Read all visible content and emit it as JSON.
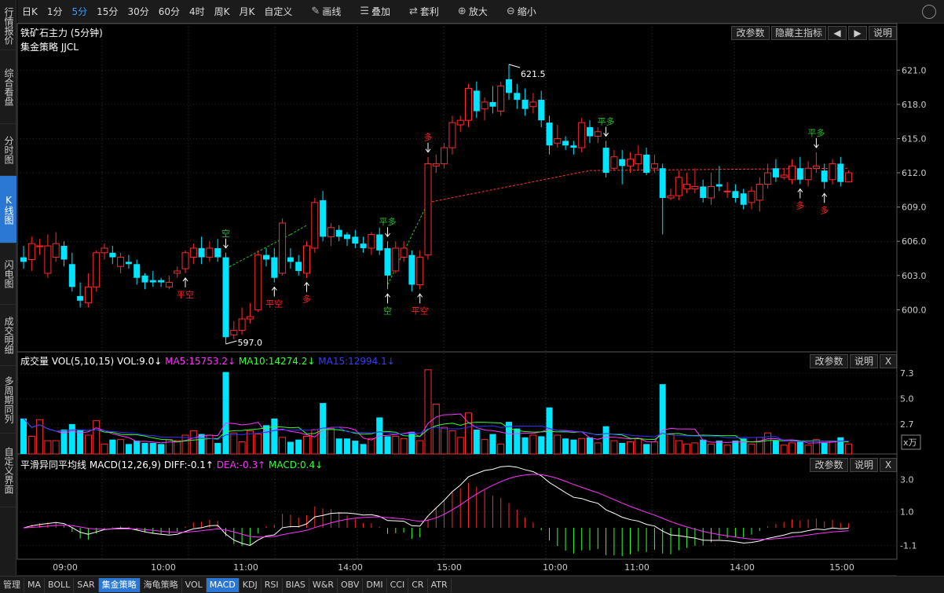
{
  "toolbar": {
    "periods": [
      "日K",
      "1分",
      "5分",
      "15分",
      "30分",
      "60分",
      "4时",
      "周K",
      "月K",
      "自定义"
    ],
    "active_period": "5分",
    "tools": [
      {
        "label": "画线",
        "icon": "pencil-icon"
      },
      {
        "label": "叠加",
        "icon": "stack-icon"
      },
      {
        "label": "套利",
        "icon": "swap-icon"
      },
      {
        "label": "放大",
        "icon": "zoom-in-icon"
      },
      {
        "label": "缩小",
        "icon": "zoom-out-icon"
      }
    ]
  },
  "sidebar": {
    "tabs": [
      "行情报价",
      "综合看盘",
      "分时图",
      "K线图",
      "闪电图",
      "成交明细",
      "多周期同列",
      "自定义界面"
    ],
    "active": "K线图"
  },
  "main_chart": {
    "title": "铁矿石主力 (5分钟)",
    "strategy": "集金策略 JJCL",
    "buttons": [
      "改参数",
      "隐藏主指标",
      "◀",
      "▶",
      "说明"
    ],
    "price_ticks": [
      "621.0",
      "618.0",
      "615.0",
      "612.0",
      "609.0",
      "606.0",
      "603.0",
      "600.0"
    ],
    "high_label": "621.5",
    "low_label": "597.0",
    "colors": {
      "up": "#ff2a2a",
      "down": "#00e5ff",
      "signal_green": "#22c522",
      "signal_red": "#ff2020",
      "line_red": "#ff3333"
    }
  },
  "volume_panel": {
    "title": "成交量",
    "params": "VOL(5,10,15)",
    "vol": "VOL:9.0↓",
    "ma5": "MA5:15753.2↓",
    "ma10": "MA10:14274.2↓",
    "ma15": "MA15:12994.1↓",
    "buttons": [
      "改参数",
      "说明",
      "X"
    ],
    "ticks": [
      "7.3",
      "5.0",
      "2.7"
    ],
    "unit": "x万",
    "colors": {
      "ma5": "#ff33ff",
      "ma10": "#33ff33",
      "ma15": "#3333ff"
    }
  },
  "macd_panel": {
    "title": "平滑异同平均线",
    "params": "MACD(12,26,9)",
    "diff": "DIFF:-0.1↑",
    "dea": "DEA:-0.3↑",
    "macd": "MACD:0.4↓",
    "buttons": [
      "改参数",
      "说明",
      "X"
    ],
    "ticks": [
      "3.0",
      "1.0",
      "-1.1"
    ]
  },
  "time_axis": [
    "09:00",
    "10:00",
    "11:00",
    "14:00",
    "15:00",
    "10:00",
    "11:00",
    "14:00",
    "15:00"
  ],
  "bottom_tabs": [
    "管理",
    "MA",
    "BOLL",
    "SAR",
    "集金策略",
    "海龟策略",
    "VOL",
    "MACD",
    "KDJ",
    "RSI",
    "BIAS",
    "W&R",
    "OBV",
    "DMI",
    "CCI",
    "CR",
    "ATR"
  ],
  "bottom_active": [
    "集金策略",
    "MACD"
  ],
  "chart_data": {
    "type": "candlestick",
    "instrument": "铁矿石主力",
    "period": "5分钟",
    "candles": [
      [
        604.6,
        604.2,
        605.6,
        603.6
      ],
      [
        604.4,
        605.8,
        606.4,
        603.4
      ],
      [
        605.6,
        605.6,
        606.2,
        604.8
      ],
      [
        603.2,
        605.6,
        606.6,
        602.8
      ],
      [
        604.6,
        605.8,
        606.8,
        604.2
      ],
      [
        605.6,
        604.4,
        606.0,
        603.8
      ],
      [
        604.0,
        602.0,
        605.0,
        601.6
      ],
      [
        601.2,
        600.8,
        602.4,
        600.2
      ],
      [
        600.6,
        602.0,
        603.2,
        600.2
      ],
      [
        602.0,
        605.0,
        605.2,
        601.6
      ],
      [
        605.0,
        605.4,
        605.8,
        604.4
      ],
      [
        605.0,
        604.6,
        605.6,
        604.0
      ],
      [
        603.8,
        604.6,
        605.0,
        603.2
      ],
      [
        604.2,
        604.0,
        604.8,
        603.6
      ],
      [
        604.0,
        602.8,
        604.4,
        602.2
      ],
      [
        603.0,
        602.4,
        603.2,
        601.8
      ],
      [
        602.6,
        602.4,
        603.4,
        602.0
      ],
      [
        602.6,
        602.4,
        602.8,
        602.0
      ],
      [
        602.0,
        602.4,
        603.0,
        601.8
      ],
      [
        603.2,
        603.4,
        603.8,
        602.8
      ],
      [
        603.6,
        605.0,
        605.2,
        603.2
      ],
      [
        604.6,
        605.4,
        605.8,
        604.0
      ],
      [
        605.4,
        604.6,
        606.4,
        604.0
      ],
      [
        604.6,
        605.4,
        606.0,
        604.2
      ],
      [
        605.4,
        604.6,
        606.2,
        604.2
      ],
      [
        604.6,
        597.6,
        605.0,
        597.0
      ],
      [
        597.8,
        598.2,
        599.0,
        597.4
      ],
      [
        598.2,
        599.2,
        600.2,
        597.8
      ],
      [
        599.2,
        599.4,
        600.6,
        598.8
      ],
      [
        600.0,
        604.8,
        605.2,
        599.8
      ],
      [
        604.8,
        604.4,
        605.4,
        603.8
      ],
      [
        604.6,
        602.8,
        605.4,
        602.4
      ],
      [
        603.2,
        607.6,
        608.0,
        603.0
      ],
      [
        604.6,
        604.2,
        605.4,
        603.6
      ],
      [
        604.2,
        603.4,
        604.8,
        603.0
      ],
      [
        603.2,
        605.6,
        606.0,
        602.8
      ],
      [
        605.4,
        609.4,
        609.8,
        605.0
      ],
      [
        609.6,
        606.4,
        610.4,
        606.0
      ],
      [
        606.4,
        607.2,
        607.6,
        605.6
      ],
      [
        607.0,
        606.4,
        607.4,
        606.0
      ],
      [
        606.6,
        606.2,
        606.8,
        605.6
      ],
      [
        606.4,
        605.8,
        607.0,
        605.4
      ],
      [
        605.8,
        605.4,
        606.4,
        605.0
      ],
      [
        605.4,
        606.6,
        606.8,
        604.8
      ],
      [
        606.6,
        605.2,
        607.2,
        604.8
      ],
      [
        605.4,
        603.0,
        606.0,
        601.8
      ],
      [
        603.4,
        605.4,
        606.0,
        603.2
      ],
      [
        604.6,
        605.4,
        606.0,
        604.2
      ],
      [
        604.8,
        602.2,
        605.2,
        601.6
      ],
      [
        602.2,
        604.6,
        605.2,
        601.8
      ],
      [
        604.8,
        612.8,
        613.4,
        604.4
      ],
      [
        612.6,
        612.8,
        613.6,
        612.0
      ],
      [
        612.8,
        614.2,
        614.6,
        612.4
      ],
      [
        614.2,
        616.4,
        617.0,
        613.6
      ],
      [
        616.2,
        616.6,
        617.0,
        615.6
      ],
      [
        616.6,
        619.4,
        619.8,
        616.0
      ],
      [
        619.2,
        617.4,
        620.0,
        616.8
      ],
      [
        617.6,
        618.2,
        618.6,
        616.6
      ],
      [
        618.2,
        617.8,
        619.6,
        617.2
      ],
      [
        617.4,
        619.6,
        620.0,
        617.0
      ],
      [
        620.2,
        619.0,
        621.5,
        618.4
      ],
      [
        619.0,
        618.4,
        619.8,
        617.6
      ],
      [
        618.4,
        617.6,
        619.4,
        617.0
      ],
      [
        617.8,
        618.2,
        619.0,
        617.2
      ],
      [
        618.4,
        616.6,
        619.2,
        616.0
      ],
      [
        616.4,
        614.4,
        617.0,
        613.6
      ],
      [
        614.6,
        615.0,
        616.2,
        614.2
      ],
      [
        614.8,
        614.4,
        615.2,
        614.0
      ],
      [
        614.4,
        614.2,
        614.8,
        613.6
      ],
      [
        614.2,
        616.4,
        616.8,
        613.8
      ],
      [
        616.0,
        615.2,
        616.6,
        614.6
      ],
      [
        615.2,
        615.6,
        616.0,
        614.6
      ],
      [
        614.2,
        612.0,
        614.8,
        611.6
      ],
      [
        612.4,
        613.4,
        614.0,
        612.2
      ],
      [
        613.2,
        612.6,
        614.0,
        611.0
      ],
      [
        612.6,
        613.2,
        613.8,
        612.0
      ],
      [
        612.8,
        613.6,
        614.4,
        612.2
      ],
      [
        613.6,
        612.0,
        614.2,
        611.8
      ],
      [
        612.4,
        612.8,
        613.6,
        612.0
      ],
      [
        612.4,
        609.8,
        612.8,
        606.6
      ],
      [
        609.8,
        610.0,
        610.6,
        609.6
      ],
      [
        610.0,
        611.6,
        612.2,
        609.6
      ],
      [
        610.6,
        611.0,
        612.0,
        610.2
      ],
      [
        610.6,
        610.8,
        612.4,
        610.2
      ],
      [
        610.8,
        609.8,
        611.4,
        609.4
      ],
      [
        609.8,
        610.8,
        612.0,
        609.2
      ],
      [
        611.0,
        610.8,
        612.6,
        610.4
      ],
      [
        610.4,
        610.4,
        611.2,
        609.8
      ],
      [
        610.4,
        609.8,
        611.0,
        609.4
      ],
      [
        610.2,
        609.2,
        610.6,
        608.8
      ],
      [
        609.4,
        610.4,
        610.8,
        608.8
      ],
      [
        609.6,
        611.0,
        611.6,
        608.6
      ],
      [
        611.0,
        612.0,
        612.8,
        610.6
      ],
      [
        612.4,
        611.6,
        613.2,
        611.2
      ],
      [
        611.6,
        611.8,
        612.4,
        611.4
      ],
      [
        611.4,
        612.6,
        613.2,
        611.0
      ],
      [
        612.4,
        611.4,
        613.4,
        611.0
      ],
      [
        611.4,
        612.4,
        613.0,
        610.8
      ],
      [
        612.4,
        612.6,
        613.8,
        612.0
      ],
      [
        612.2,
        611.2,
        612.8,
        610.6
      ],
      [
        611.4,
        612.8,
        613.2,
        611.0
      ],
      [
        612.8,
        611.2,
        613.4,
        610.8
      ],
      [
        611.2,
        612.0,
        612.2,
        611.6
      ]
    ],
    "volumes": [
      3.2,
      1.6,
      3.1,
      1.2,
      1.2,
      2.2,
      2.7,
      2.2,
      1.7,
      3.0,
      0.9,
      1.3,
      1.3,
      0.9,
      1.2,
      1.0,
      1.0,
      0.9,
      1.3,
      1.2,
      1.7,
      2.1,
      1.8,
      1.7,
      1.0,
      7.4,
      1.9,
      1.1,
      2.1,
      1.8,
      2.6,
      3.2,
      1.5,
      1.1,
      1.3,
      1.6,
      2.2,
      4.6,
      2.3,
      1.4,
      1.4,
      1.2,
      0.9,
      1.4,
      3.3,
      1.6,
      1.6,
      1.4,
      2.0,
      1.2,
      7.6,
      4.5,
      2.4,
      2.1,
      1.5,
      3.7,
      2.2,
      1.3,
      1.8,
      0.9,
      2.9,
      2.3,
      1.5,
      1.7,
      1.6,
      4.2,
      1.7,
      1.4,
      1.3,
      1.4,
      1.5,
      1.0,
      2.5,
      1.2,
      1.0,
      1.1,
      1.4,
      0.9,
      1.1,
      6.3,
      1.8,
      1.2,
      0.9,
      1.0,
      1.3,
      0.9,
      1.2,
      0.8,
      1.2,
      1.4,
      0.9,
      1.5,
      1.9,
      1.2,
      0.8,
      1.0,
      1.1,
      0.8,
      1.3,
      1.0,
      1.1,
      1.5,
      0.9
    ],
    "signals": [
      {
        "label": "平空",
        "index": 20,
        "side": "below",
        "color": "red"
      },
      {
        "label": "空",
        "index": 25,
        "side": "above",
        "color": "green"
      },
      {
        "label": "平空",
        "index": 31,
        "side": "below",
        "color": "red"
      },
      {
        "label": "多",
        "index": 35,
        "side": "below",
        "color": "red"
      },
      {
        "label": "平多",
        "index": 45,
        "side": "above",
        "color": "green"
      },
      {
        "label": "空",
        "index": 45,
        "side": "below",
        "color": "green"
      },
      {
        "label": "平空",
        "index": 49,
        "side": "below",
        "color": "red"
      },
      {
        "label": "多",
        "index": 50,
        "side": "above",
        "color": "red"
      },
      {
        "label": "平多",
        "index": 72,
        "side": "above",
        "color": "green"
      },
      {
        "label": "多",
        "index": 96,
        "side": "below",
        "color": "red"
      },
      {
        "label": "平多",
        "index": 98,
        "side": "above",
        "color": "green"
      },
      {
        "label": "多",
        "index": 99,
        "side": "below",
        "color": "red"
      }
    ],
    "price_range": [
      597.0,
      621.5
    ],
    "yticks": [
      600,
      603,
      606,
      609,
      612,
      615,
      618,
      621
    ]
  }
}
